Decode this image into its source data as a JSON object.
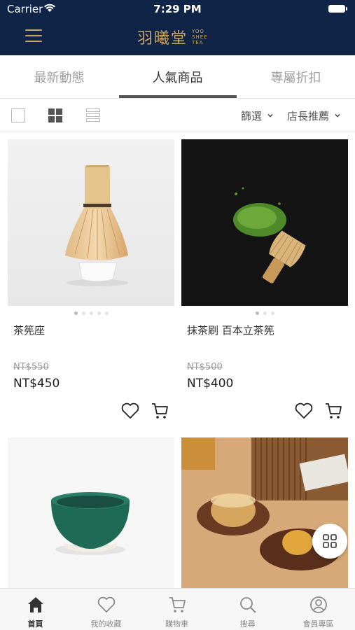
{
  "status_bar": {
    "carrier": "Carrier",
    "time": "7:29 PM"
  },
  "header": {
    "logo_cn": "羽曦堂",
    "logo_en_1": "YOO",
    "logo_en_2": "SHEE",
    "logo_en_3": "TEA"
  },
  "tabs": [
    {
      "label": "最新動態"
    },
    {
      "label": "人氣商品"
    },
    {
      "label": "專屬折扣"
    }
  ],
  "filters": {
    "filter_label": "篩選",
    "sort_label": "店長推薦"
  },
  "products": [
    {
      "name": "茶筅座",
      "old_price": "NT$550",
      "price": "NT$450"
    },
    {
      "name": "抹茶刷 百本立茶筅",
      "old_price": "NT$500",
      "price": "NT$400"
    }
  ],
  "bottom_nav": [
    {
      "label": "首頁"
    },
    {
      "label": "我的收藏"
    },
    {
      "label": "購物車"
    },
    {
      "label": "搜尋"
    },
    {
      "label": "會員專區"
    }
  ],
  "colors": {
    "header_bg": "#0f2447",
    "brand_gold": "#c9a66b"
  },
  "icons": [
    "menu-icon",
    "wifi-icon",
    "battery-icon",
    "grid-view-icon",
    "list-view-icon",
    "chevron-down-icon",
    "heart-icon",
    "cart-icon",
    "home-icon",
    "search-icon",
    "user-icon",
    "apps-icon"
  ]
}
